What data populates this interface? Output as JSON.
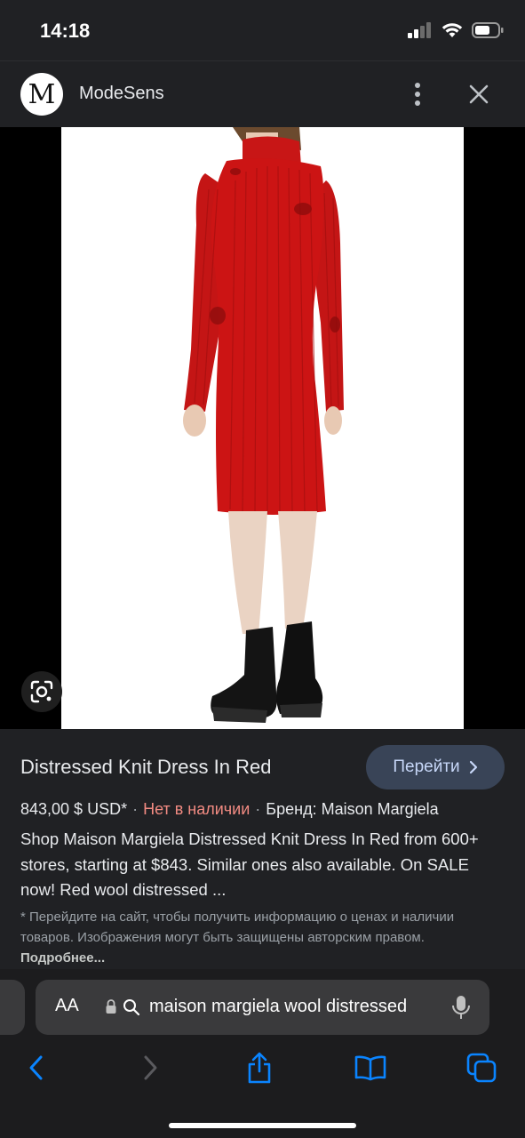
{
  "status_bar": {
    "time": "14:18"
  },
  "header": {
    "logo_letter": "M",
    "site_name": "ModeSens"
  },
  "product": {
    "title": "Distressed Knit Dress In Red",
    "go_button": "Перейти",
    "price": "843,00 $ USD*",
    "availability": "Нет в наличии",
    "brand": "Бренд: Maison Margiela",
    "description": "Shop Maison Margiela Distressed Knit Dress In Red from 600+ stores, starting at $843. Similar ones also available. On SALE now! Red wool distressed ...",
    "disclaimer": "* Перейдите на сайт, чтобы получить информацию о ценах и наличии товаров. Изображения могут быть защищены авторским правом.",
    "more_link": "Подробнее..."
  },
  "address_bar": {
    "aa_label": "AA",
    "url": "maison margiela wool distressed"
  },
  "colors": {
    "background": "#202124",
    "dress_red": "#cc1414",
    "out_of_stock": "#f28b82",
    "button_bg": "#394457",
    "button_text": "#c7d7f8",
    "safari_accent": "#0a84ff"
  },
  "icons": {
    "lens": "google-lens-icon",
    "kebab": "more-vert-icon",
    "close": "close-icon",
    "lock": "lock-icon",
    "search": "search-icon",
    "mic": "microphone-icon",
    "back": "back-chevron-icon",
    "forward": "forward-chevron-icon",
    "share": "share-icon",
    "bookmarks": "bookmarks-icon",
    "tabs": "tabs-icon"
  }
}
